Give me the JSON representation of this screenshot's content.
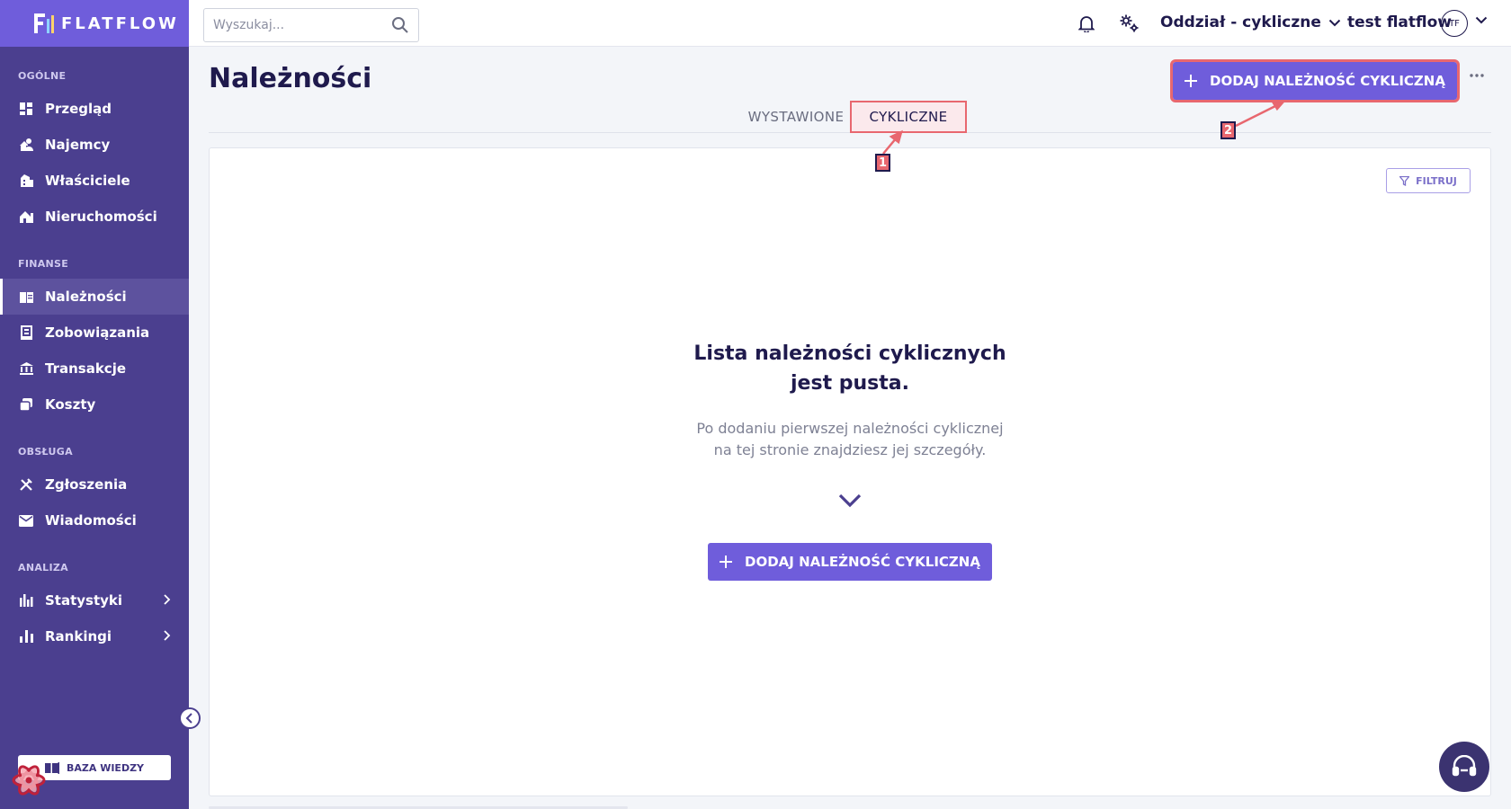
{
  "brand": {
    "name": "FLATFLOW"
  },
  "sidebar": {
    "sections": [
      {
        "label": "OGÓLNE",
        "items": [
          {
            "label": "Przegląd",
            "icon": "dashboard-icon"
          },
          {
            "label": "Najemcy",
            "icon": "tenants-icon"
          },
          {
            "label": "Właściciele",
            "icon": "owners-icon"
          },
          {
            "label": "Nieruchomości",
            "icon": "property-icon"
          }
        ]
      },
      {
        "label": "FINANSE",
        "items": [
          {
            "label": "Należności",
            "icon": "receivables-icon",
            "active": true
          },
          {
            "label": "Zobowiązania",
            "icon": "liabilities-icon"
          },
          {
            "label": "Transakcje",
            "icon": "bank-icon"
          },
          {
            "label": "Koszty",
            "icon": "costs-icon"
          }
        ]
      },
      {
        "label": "OBSŁUGA",
        "items": [
          {
            "label": "Zgłoszenia",
            "icon": "tools-icon"
          },
          {
            "label": "Wiadomości",
            "icon": "mail-icon"
          }
        ]
      },
      {
        "label": "ANALIZA",
        "items": [
          {
            "label": "Statystyki",
            "icon": "stats-icon",
            "expandable": true
          },
          {
            "label": "Rankingi",
            "icon": "ranking-icon",
            "expandable": true
          }
        ]
      }
    ],
    "knowledge_base": "BAZA WIEDZY"
  },
  "topbar": {
    "search_placeholder": "Wyszukaj...",
    "branch": "Oddział - cykliczne",
    "user_name": "test flatflow",
    "user_initials": "TF"
  },
  "main": {
    "title": "Należności",
    "add_button": "DODAJ NALEŻNOŚĆ CYKLICZNĄ",
    "tabs": [
      {
        "label": "WYSTAWIONE",
        "active": false
      },
      {
        "label": "CYKLICZNE",
        "active": true
      }
    ],
    "filter_label": "FILTRUJ",
    "empty_title_line1": "Lista należności cyklicznych",
    "empty_title_line2": "jest pusta.",
    "empty_sub_line1": "Po dodaniu pierwszej należności cyklicznej",
    "empty_sub_line2": "na tej stronie znajdziesz jej szczegóły."
  },
  "annotations": {
    "badge_1": "1",
    "badge_2": "2"
  },
  "colors": {
    "sidebar": "#4b3f8f",
    "accent": "#6f5ddb",
    "highlight": "#e8676f"
  }
}
